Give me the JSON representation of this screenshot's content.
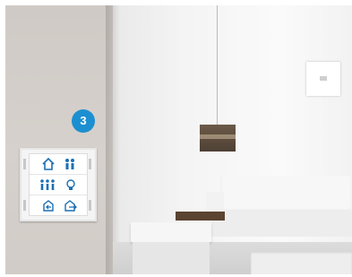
{
  "callout": {
    "number": "3",
    "color": "#1c8fd1"
  },
  "switch_panel": {
    "keys": [
      {
        "row": 1,
        "left_icon": "home-icon",
        "right_icon": "people-icon"
      },
      {
        "row": 2,
        "left_icon": "group-icon",
        "right_icon": "bulb-icon"
      },
      {
        "row": 3,
        "left_icon": "enter-home-icon",
        "right_icon": "leave-home-icon"
      }
    ]
  },
  "colors": {
    "wall_left": "#d2cdc8",
    "room_wall": "#f4f4f4",
    "lamp_shade": "#5b4a3b",
    "side_table": "#5a4331"
  }
}
